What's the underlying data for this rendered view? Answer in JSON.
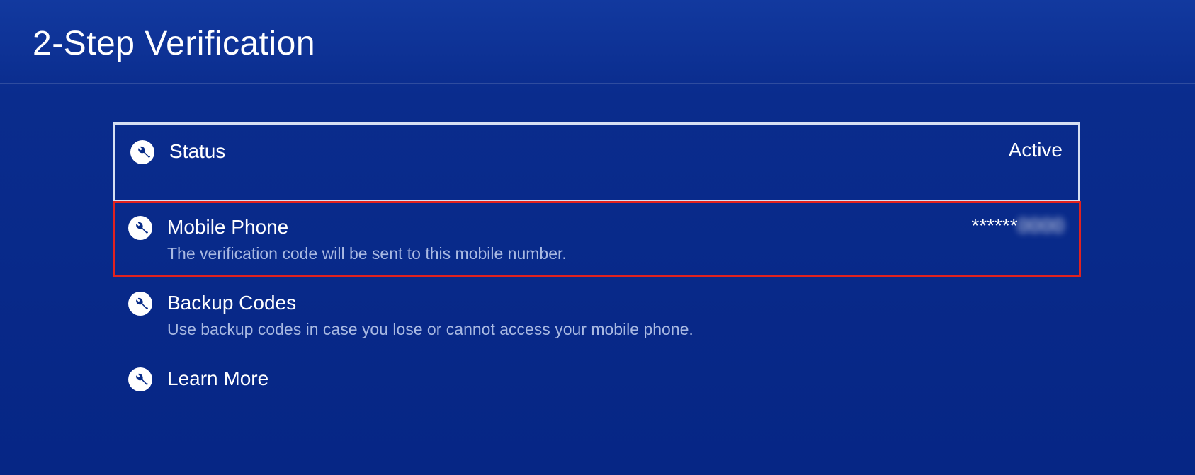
{
  "page": {
    "title": "2-Step Verification"
  },
  "items": {
    "status": {
      "label": "Status",
      "value": "Active"
    },
    "mobile_phone": {
      "label": "Mobile Phone",
      "desc": "The verification code will be sent to this mobile number.",
      "masked_prefix": "******",
      "masked_suffix": "0000"
    },
    "backup_codes": {
      "label": "Backup Codes",
      "desc": "Use backup codes in case you lose or cannot access your mobile phone."
    },
    "learn_more": {
      "label": "Learn More"
    }
  },
  "icons": {
    "wrench": "wrench-icon"
  },
  "colors": {
    "background_top": "#12399f",
    "background_bottom": "#062685",
    "selected_outline": "#d6dff2",
    "highlight_outline": "#e1221f",
    "desc_text": "#a9b9e2"
  }
}
